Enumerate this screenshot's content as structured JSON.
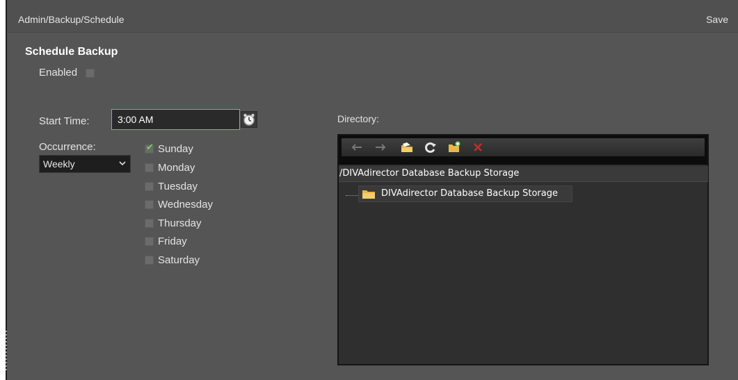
{
  "header": {
    "breadcrumb": "Admin/Backup/Schedule",
    "save_label": "Save"
  },
  "schedule": {
    "title": "Schedule Backup",
    "enabled_label": "Enabled",
    "enabled": false,
    "start_time_label": "Start Time:",
    "start_time_value": "3:00 AM",
    "occurrence_label": "Occurrence:",
    "occurrence_value": "Weekly",
    "days": [
      {
        "label": "Sunday",
        "checked": true
      },
      {
        "label": "Monday",
        "checked": false
      },
      {
        "label": "Tuesday",
        "checked": false
      },
      {
        "label": "Wednesday",
        "checked": false
      },
      {
        "label": "Thursday",
        "checked": false
      },
      {
        "label": "Friday",
        "checked": false
      },
      {
        "label": "Saturday",
        "checked": false
      }
    ]
  },
  "directory": {
    "label": "Directory:",
    "path": "/DIVAdirector Database Backup Storage",
    "tree_items": [
      {
        "label": "DIVAdirector Database Backup Storage"
      }
    ],
    "toolbar_icons": [
      "back-arrow-icon",
      "forward-arrow-icon",
      "open-folder-icon",
      "refresh-icon",
      "new-folder-icon",
      "delete-icon"
    ]
  },
  "colors": {
    "background": "#555555",
    "accent_border": "#7ea0d8",
    "check": "#6fdc4f",
    "delete": "#c0302a",
    "folder": "#e8b84a"
  }
}
